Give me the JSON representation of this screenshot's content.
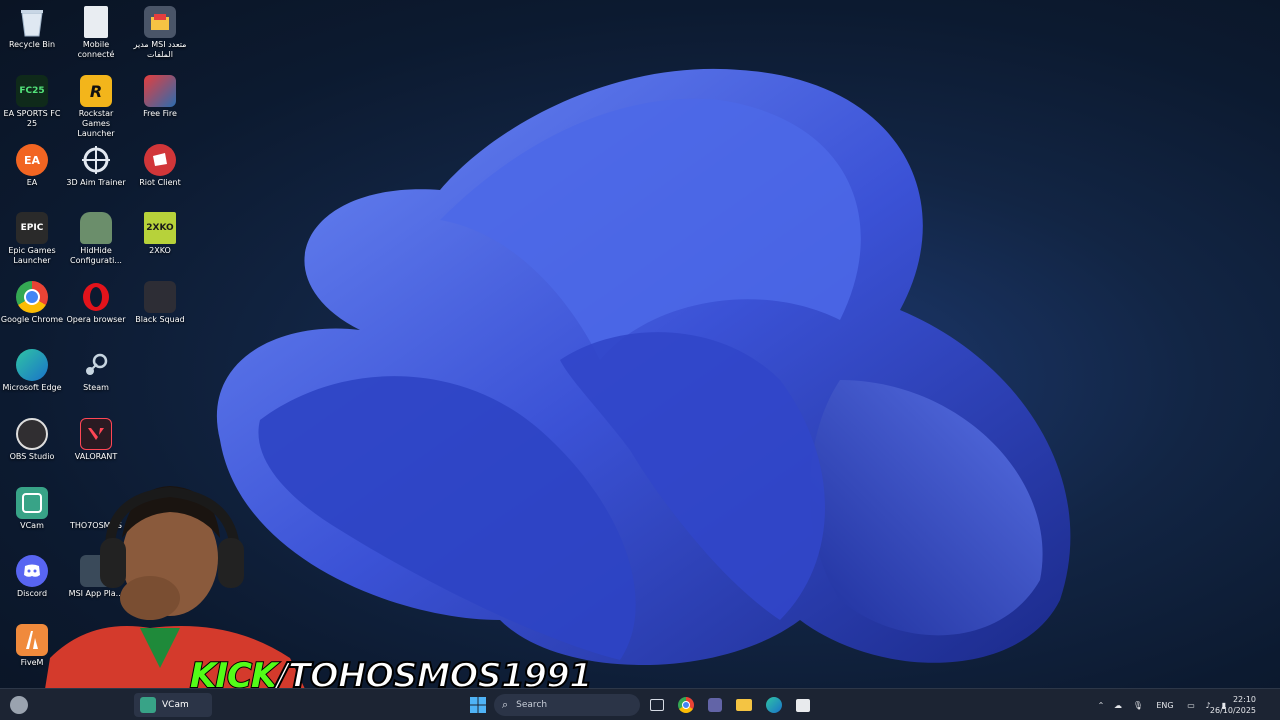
{
  "desktop": {
    "icons": [
      {
        "label": "Recycle Bin"
      },
      {
        "label": "Mobile connecté"
      },
      {
        "label": "مدير MSI متعدد الملفات"
      },
      {
        "label": "EA SPORTS FC 25"
      },
      {
        "label": "Rockstar Games Launcher"
      },
      {
        "label": "Free Fire"
      },
      {
        "label": "EA"
      },
      {
        "label": "3D Aim Trainer"
      },
      {
        "label": "Riot Client"
      },
      {
        "label": "Epic Games Launcher"
      },
      {
        "label": "HidHide Configurati..."
      },
      {
        "label": "2XKO"
      },
      {
        "label": "Google Chrome"
      },
      {
        "label": "Opera browser"
      },
      {
        "label": "Black Squad"
      },
      {
        "label": "Microsoft Edge"
      },
      {
        "label": "Steam"
      },
      {
        "label": "OBS Studio"
      },
      {
        "label": "VALORANT"
      },
      {
        "label": "VCam"
      },
      {
        "label": "THO7OSMOS"
      },
      {
        "label": "Discord"
      },
      {
        "label": "MSI App Pla..."
      },
      {
        "label": "FiveM"
      }
    ],
    "icon_glyphs": {
      "ea_sports": "FC25",
      "rockstar": "R",
      "ea": "EA",
      "epic": "EPIC",
      "twoxko": "2XKO"
    }
  },
  "overlay": {
    "brand": "KICK",
    "handle": "/TOHOSMOS1991"
  },
  "taskbar": {
    "vcam_label": "VCam",
    "search_placeholder": "Search",
    "language": "ENG",
    "time": "22:10",
    "date": "26/10/2025"
  },
  "colors": {
    "taskbar_bg": "#1c2433",
    "kick_green": "#53fc18",
    "wallpaper_blue": "#3a5bd9"
  }
}
